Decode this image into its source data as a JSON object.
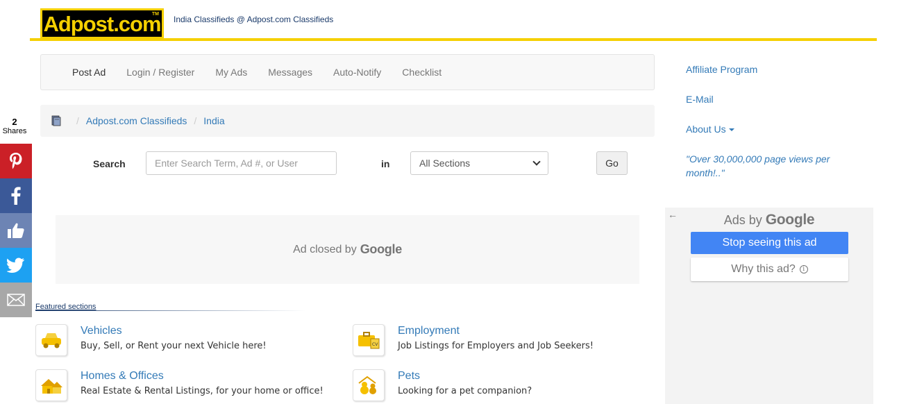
{
  "header": {
    "logo_text": "Adpost.com",
    "logo_tm": "TM",
    "tagline": "India Classifieds @ Adpost.com Classifieds"
  },
  "nav": {
    "items": [
      "Post Ad",
      "Login / Register",
      "My Ads",
      "Messages",
      "Auto-Notify",
      "Checklist"
    ]
  },
  "breadcrumb": {
    "icon": "book-icon",
    "items": [
      "Adpost.com Classifieds",
      "India"
    ],
    "separator": "/"
  },
  "search": {
    "label": "Search",
    "placeholder": "Enter Search Term, Ad #, or User",
    "in_label": "in",
    "section_selected": "All Sections",
    "go_label": "Go"
  },
  "ad_closed": {
    "text": "Ad closed by",
    "brand": "Google"
  },
  "featured": {
    "title": "Featured sections",
    "sections": [
      {
        "title": "Vehicles",
        "desc": "Buy, Sell, or Rent your next Vehicle here!",
        "icon": "car-icon"
      },
      {
        "title": "Employment",
        "desc": "Job Listings for Employers and Job Seekers!",
        "icon": "briefcase-cv-icon"
      },
      {
        "title": "Homes & Offices",
        "desc": "Real Estate & Rental Listings, for your home or office!",
        "icon": "house-icon"
      },
      {
        "title": "Pets",
        "desc": "Looking for a pet companion?",
        "icon": "pets-icon"
      }
    ]
  },
  "share": {
    "count": "2",
    "label": "Shares",
    "buttons": [
      {
        "name": "pinterest",
        "icon": "pinterest-icon",
        "color": "#cb2027"
      },
      {
        "name": "facebook",
        "icon": "facebook-icon",
        "color": "#3b5998"
      },
      {
        "name": "like",
        "icon": "thumbs-up-icon",
        "color": "#6d84b4"
      },
      {
        "name": "twitter",
        "icon": "twitter-icon",
        "color": "#1da1f2"
      },
      {
        "name": "email",
        "icon": "email-icon",
        "color": "#a8a8a8"
      }
    ]
  },
  "right": {
    "affiliate": "Affiliate Program",
    "email": "E-Mail",
    "about": "About Us",
    "quote": "\"Over 30,000,000 page views per month!..\""
  },
  "google_ad": {
    "ads_by": "Ads by",
    "brand": "Google",
    "stop_label": "Stop seeing this ad",
    "why_label": "Why this ad?",
    "back_icon": "←"
  },
  "colors": {
    "brand_yellow": "#f5d000",
    "link_blue": "#337ab7",
    "google_blue": "#4285f4"
  }
}
